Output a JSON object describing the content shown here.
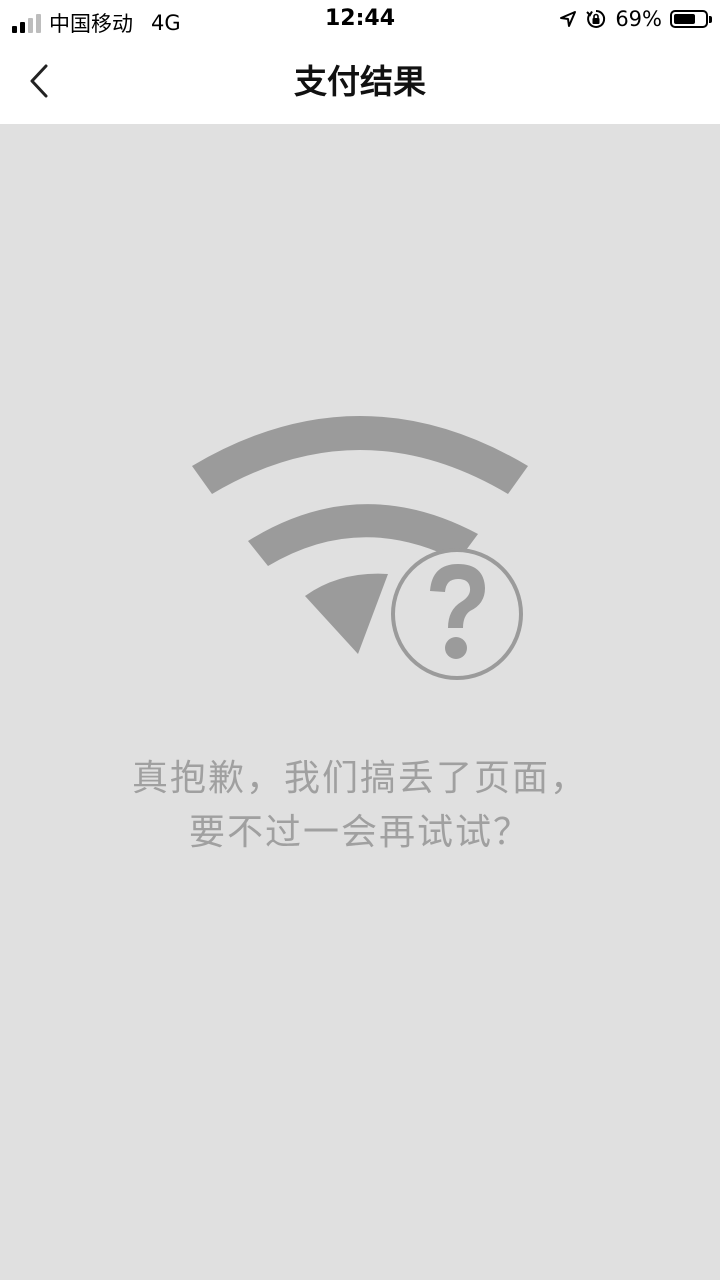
{
  "status_bar": {
    "carrier": "中国移动",
    "network": "4G",
    "time": "12:44",
    "battery_percent": "69%",
    "battery_level": 0.69,
    "signal_bars_active": 2,
    "signal_bars_total": 4,
    "icons": [
      "signal-icon",
      "location-arrow-icon",
      "orientation-lock-icon",
      "battery-icon"
    ]
  },
  "nav": {
    "title": "支付结果",
    "back_icon": "chevron-left-icon"
  },
  "error": {
    "icon": "wifi-question-icon",
    "line1": "真抱歉，我们搞丢了页面，",
    "line2": "要不过一会再试试？"
  },
  "colors": {
    "background": "#e0e0e0",
    "illustration": "#9b9b9b",
    "message_text": "#a0a0a0"
  }
}
